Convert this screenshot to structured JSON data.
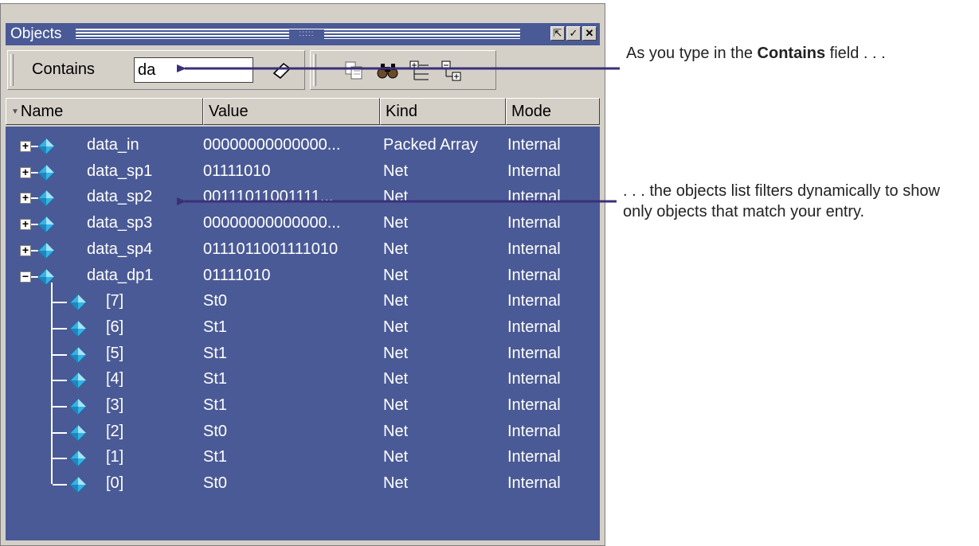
{
  "window": {
    "title": "Objects"
  },
  "toolbar": {
    "contains_label": "Contains",
    "contains_value": "da"
  },
  "columns": [
    "Name",
    "Value",
    "Kind",
    "Mode"
  ],
  "rows": [
    {
      "name": "data_in",
      "value": "00000000000000...",
      "kind": "Packed Array",
      "mode": "Internal",
      "expander": "+"
    },
    {
      "name": "data_sp1",
      "value": "01111010",
      "kind": "Net",
      "mode": "Internal",
      "expander": "+"
    },
    {
      "name": "data_sp2",
      "value": "00111011001111...",
      "kind": "Net",
      "mode": "Internal",
      "expander": "+"
    },
    {
      "name": "data_sp3",
      "value": "00000000000000...",
      "kind": "Net",
      "mode": "Internal",
      "expander": "+"
    },
    {
      "name": "data_sp4",
      "value": "0111011001111010",
      "kind": "Net",
      "mode": "Internal",
      "expander": "+"
    },
    {
      "name": "data_dp1",
      "value": "01111010",
      "kind": "Net",
      "mode": "Internal",
      "expander": "−"
    },
    {
      "name": "[7]",
      "value": "St0",
      "kind": "Net",
      "mode": "Internal"
    },
    {
      "name": "[6]",
      "value": "St1",
      "kind": "Net",
      "mode": "Internal"
    },
    {
      "name": "[5]",
      "value": "St1",
      "kind": "Net",
      "mode": "Internal"
    },
    {
      "name": "[4]",
      "value": "St1",
      "kind": "Net",
      "mode": "Internal"
    },
    {
      "name": "[3]",
      "value": "St1",
      "kind": "Net",
      "mode": "Internal"
    },
    {
      "name": "[2]",
      "value": "St0",
      "kind": "Net",
      "mode": "Internal"
    },
    {
      "name": "[1]",
      "value": "St1",
      "kind": "Net",
      "mode": "Internal"
    },
    {
      "name": "[0]",
      "value": "St0",
      "kind": "Net",
      "mode": "Internal"
    }
  ],
  "annotations": {
    "contains_prefix": "As you type in the ",
    "contains_bold": "Contains",
    "contains_suffix": " field . . .",
    "filter_text": ". . . the objects list filters dynamically to show only objects that match your entry."
  },
  "colors": {
    "list_bg": "#4a5a96",
    "arrow": "#3b2f7a",
    "diamond": "#35b3e8"
  },
  "icons": [
    "sort-arrow-icon",
    "eraser-icon",
    "copy-icon",
    "find-icon",
    "expand-tree-icon",
    "collapse-tree-icon",
    "float-icon",
    "dock-icon",
    "close-icon",
    "net-diamond-icon",
    "expand-icon",
    "collapse-icon"
  ]
}
